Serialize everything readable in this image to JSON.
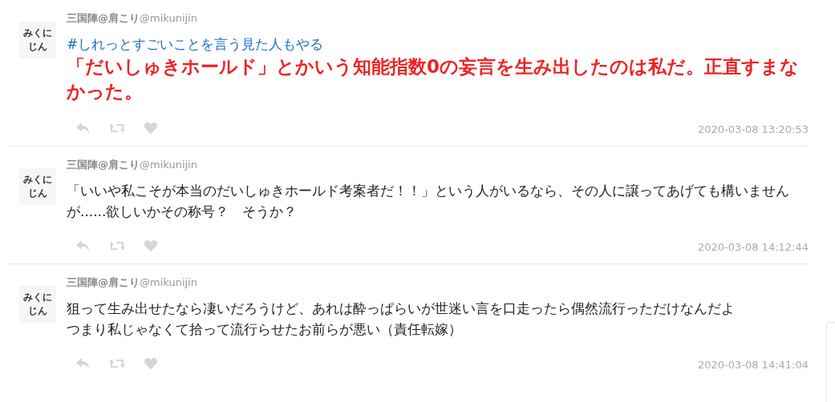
{
  "posts": [
    {
      "avatar": [
        "みくに",
        "じん"
      ],
      "name": "三国陣@肩こり",
      "handle": "@mikunijin",
      "body": [
        {
          "kind": "hashtag",
          "text": "#しれっとすごいことを言う見た人もやる"
        },
        {
          "kind": "emphasis",
          "text": "「だいしゅきホールド」とかいう知能指数0の妄言を生み出したのは私だ。正直すまなかった。"
        }
      ],
      "time": "2020-03-08 13:20:53"
    },
    {
      "avatar": [
        "みくに",
        "じん"
      ],
      "name": "三国陣@肩こり",
      "handle": "@mikunijin",
      "body": [
        {
          "kind": "plain",
          "text": "「いいや私こそが本当のだいしゅきホールド考案者だ！！」という人がいるなら、その人に譲ってあげても構いませんが......欲しいかその称号？　そうか？"
        }
      ],
      "time": "2020-03-08 14:12:44"
    },
    {
      "avatar": [
        "みくに",
        "じん"
      ],
      "name": "三国陣@肩こり",
      "handle": "@mikunijin",
      "body": [
        {
          "kind": "plain",
          "text": "狙って生み出せたなら凄いだろうけど、あれは酔っぱらいが世迷い言を口走ったら偶然流行っただけなんだよ"
        },
        {
          "kind": "plain",
          "text": "つまり私じゃなくて拾って流行らせたお前らが悪い（責任転嫁）"
        }
      ],
      "time": "2020-03-08 14:41:04"
    }
  ]
}
